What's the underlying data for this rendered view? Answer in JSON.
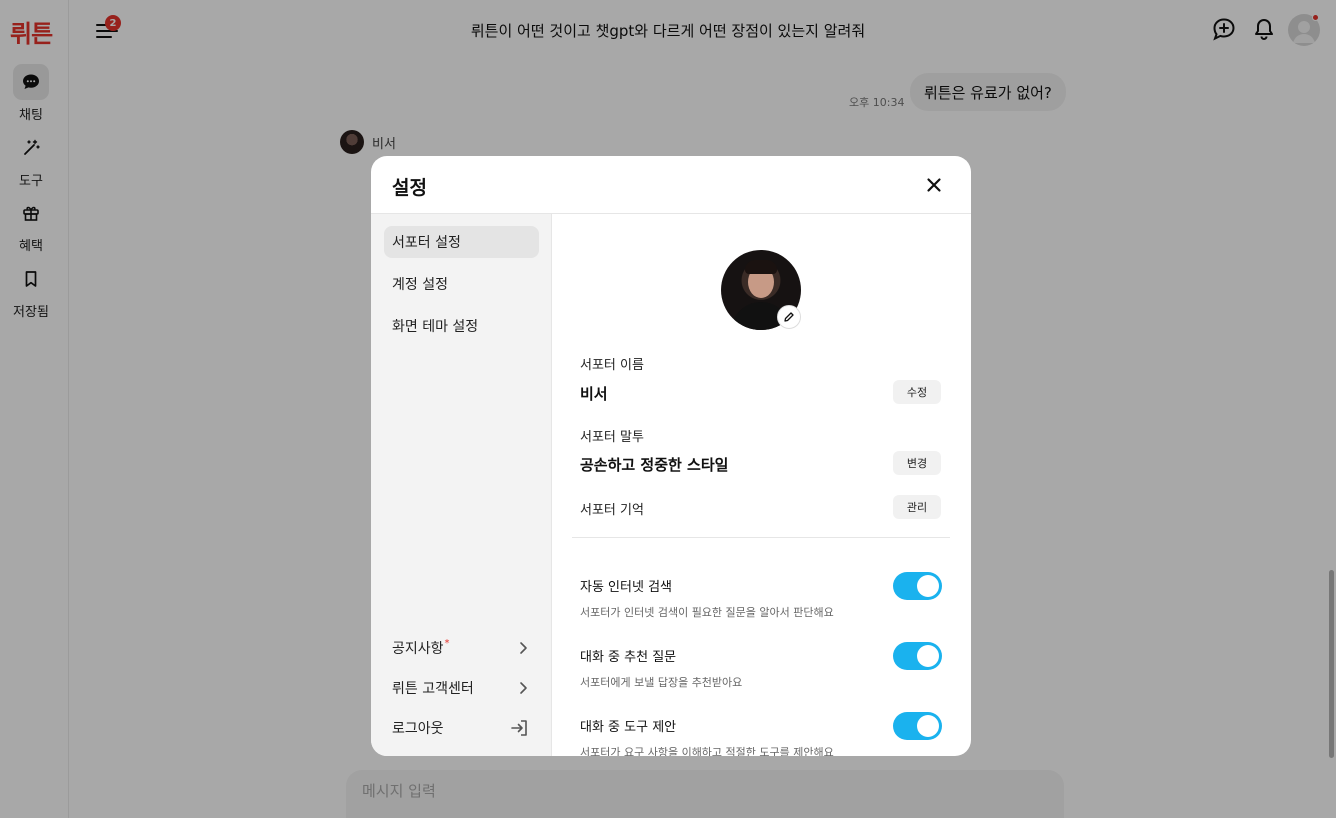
{
  "app": {
    "logo": "뤼튼",
    "chat_title": "뤼튼이 어떤 것이고 챗gpt와 다르게 어떤 장점이 있는지 알려줘",
    "menu_badge": "2"
  },
  "nav": [
    {
      "label": "채팅",
      "icon": "chat-bubble-icon"
    },
    {
      "label": "도구",
      "icon": "magic-wand-icon"
    },
    {
      "label": "혜택",
      "icon": "gift-icon"
    },
    {
      "label": "저장됨",
      "icon": "bookmark-icon"
    }
  ],
  "chat": {
    "user_time": "오후 10:34",
    "user_message": "뤼튼은 유료가 없어?",
    "bot_name": "비서",
    "input_placeholder": "메시지 입력"
  },
  "modal": {
    "title": "설정",
    "side_items": [
      "서포터 설정",
      "계정 설정",
      "화면 테마 설정"
    ],
    "side_footer": [
      {
        "label": "공지사항",
        "marker": "*",
        "icon": "chevron-right-icon"
      },
      {
        "label": "뤼튼 고객센터",
        "icon": "chevron-right-icon"
      },
      {
        "label": "로그아웃",
        "icon": "logout-icon"
      }
    ],
    "supporter_name_label": "서포터 이름",
    "supporter_name": "비서",
    "edit_label": "수정",
    "supporter_tone_label": "서포터 말투",
    "supporter_tone": "공손하고 정중한 스타일",
    "change_label": "변경",
    "supporter_memory_label": "서포터 기억",
    "manage_label": "관리",
    "toggles": [
      {
        "title": "자동 인터넷 검색",
        "desc": "서포터가 인터넷 검색이 필요한 질문을 알아서 판단해요",
        "on": true
      },
      {
        "title": "대화 중 추천 질문",
        "desc": "서포터에게 보낼 답장을 추천받아요",
        "on": true
      },
      {
        "title": "대화 중 도구 제안",
        "desc": "서포터가 요구 사항을 이해하고 적절한 도구를 제안해요",
        "on": true
      }
    ]
  },
  "colors": {
    "brand": "#e5322b",
    "toggle_on": "#1ab2ee"
  }
}
